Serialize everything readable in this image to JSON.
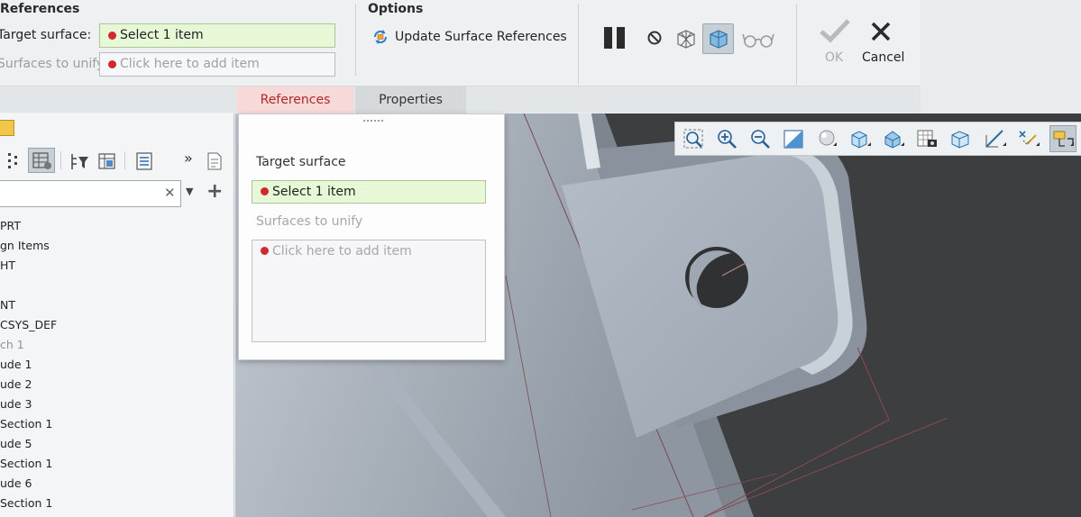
{
  "ribbon": {
    "references": {
      "title": "References",
      "target_label": "Target surface:",
      "target_value": "Select 1 item",
      "unify_label": "Surfaces to unify:",
      "unify_placeholder": "Click here to add item"
    },
    "options": {
      "title": "Options",
      "update_button": "Update Surface References"
    },
    "tool_icons": [
      "pause-icon",
      "no-entry-icon",
      "wireframe-preview-icon",
      "surface-preview-icon",
      "glasses-icon"
    ],
    "ok_label": "OK",
    "cancel_label": "Cancel"
  },
  "tabs": [
    {
      "label": "References",
      "active": true
    },
    {
      "label": "Properties",
      "active": false
    }
  ],
  "tree": {
    "items": [
      {
        "label": "PRT",
        "dim": false
      },
      {
        "label": "gn Items",
        "dim": false
      },
      {
        "label": "HT",
        "dim": false
      },
      {
        "label": "",
        "dim": false
      },
      {
        "label": "NT",
        "dim": false
      },
      {
        "label": "CSYS_DEF",
        "dim": false
      },
      {
        "label": "ch 1",
        "dim": true
      },
      {
        "label": "ude 1",
        "dim": false
      },
      {
        "label": "ude 2",
        "dim": false
      },
      {
        "label": "ude 3",
        "dim": false
      },
      {
        "label": "Section 1",
        "dim": false
      },
      {
        "label": "ude 5",
        "dim": false
      },
      {
        "label": "Section 1",
        "dim": false
      },
      {
        "label": "ude 6",
        "dim": false
      },
      {
        "label": "Section 1",
        "dim": false
      }
    ]
  },
  "ref_panel": {
    "target_label": "Target surface",
    "target_value": "Select 1 item",
    "unify_label": "Surfaces to unify",
    "unify_placeholder": "Click here to add item"
  },
  "colors": {
    "active_field": "#e6f8d6",
    "required_dot": "#d0282e",
    "active_tab": "#f7d9d8",
    "active_tab_text": "#b3262a",
    "model_surface": "#a4adb8",
    "viewport_dark": "#3a3c3e"
  }
}
